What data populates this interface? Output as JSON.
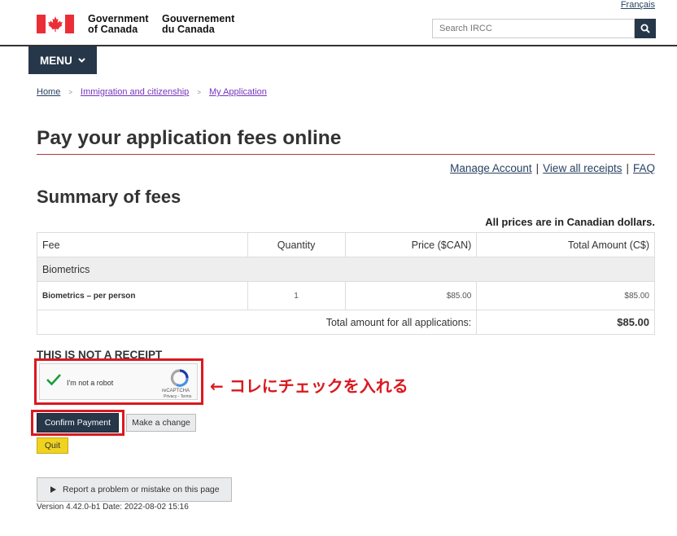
{
  "header": {
    "lang_link": "Français",
    "sig_en_line1": "Government",
    "sig_en_line2": "of Canada",
    "sig_fr_line1": "Gouvernement",
    "sig_fr_line2": "du Canada",
    "search_placeholder": "Search IRCC",
    "menu_label": "MENU"
  },
  "breadcrumb": [
    "Home",
    "Immigration and citizenship",
    "My Application"
  ],
  "page_title": "Pay your application fees online",
  "account_links": [
    "Manage Account",
    "View all receipts",
    "FAQ"
  ],
  "summary_title": "Summary of fees",
  "price_note": "All prices are in Canadian dollars.",
  "table": {
    "headers": [
      "Fee",
      "Quantity",
      "Price ($CAN)",
      "Total Amount (C$)"
    ],
    "group": "Biometrics",
    "rows": [
      {
        "fee": "Biometrics – per person",
        "quantity": "1",
        "price": "$85.00",
        "total": "$85.00"
      }
    ],
    "total_label": "Total amount for all applications:",
    "total_value": "$85.00"
  },
  "not_receipt": "THIS IS NOT A RECEIPT",
  "recaptcha": {
    "label": "I'm not a robot",
    "brand": "reCAPTCHA",
    "terms": "Privacy - Terms",
    "checked": true
  },
  "annotation": "← コレにチェックを入れる",
  "buttons": {
    "confirm": "Confirm Payment",
    "change": "Make a change",
    "quit": "Quit",
    "report": "Report a problem or mistake on this page"
  },
  "version": "Version 4.42.0-b1 Date: 2022-08-02 15:16",
  "colors": {
    "flag_red": "#eb2d37",
    "navy": "#26374a",
    "link": "#284162",
    "annotation_red": "#d9191f",
    "quit_yellow": "#f0d31f"
  }
}
